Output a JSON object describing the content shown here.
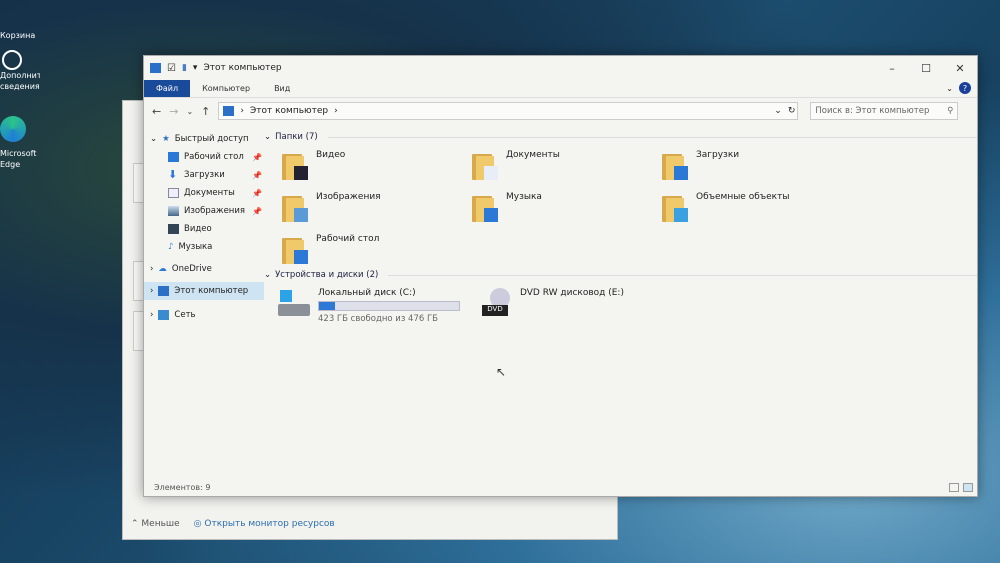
{
  "desktop": {
    "icons": [
      {
        "label": "Корзина"
      },
      {
        "label": "Дополнительные сведения о..."
      },
      {
        "label": "Microsoft Edge"
      }
    ]
  },
  "background_window": {
    "less_label": "Меньше",
    "open_resource_monitor": "Открыть монитор ресурсов"
  },
  "window": {
    "title": "Этот компьютер",
    "ribbon_tabs": [
      "Файл",
      "Компьютер",
      "Вид"
    ],
    "address": {
      "path": "Этот компьютер"
    },
    "search": {
      "placeholder": "Поиск в: Этот компьютер"
    },
    "nav": {
      "quick_access": "Быстрый доступ",
      "items": [
        {
          "label": "Рабочий стол",
          "pinned": true
        },
        {
          "label": "Загрузки",
          "pinned": true
        },
        {
          "label": "Документы",
          "pinned": true
        },
        {
          "label": "Изображения",
          "pinned": true
        },
        {
          "label": "Видео",
          "pinned": false
        },
        {
          "label": "Музыка",
          "pinned": false
        }
      ],
      "onedrive": "OneDrive",
      "this_pc": "Этот компьютер",
      "network": "Сеть"
    },
    "folders_header": "Папки (7)",
    "folders": [
      {
        "label": "Видео"
      },
      {
        "label": "Документы"
      },
      {
        "label": "Загрузки"
      },
      {
        "label": "Изображения"
      },
      {
        "label": "Музыка"
      },
      {
        "label": "Объемные объекты"
      },
      {
        "label": "Рабочий стол"
      }
    ],
    "devices_header": "Устройства и диски (2)",
    "drives": [
      {
        "label": "Локальный диск (C:)",
        "free_text": "423 ГБ свободно из 476 ГБ",
        "used_fraction": 0.111
      },
      {
        "label": "DVD RW дисковод (E:)"
      }
    ],
    "status": "Элементов: 9",
    "accent": "#1a4a9a"
  }
}
